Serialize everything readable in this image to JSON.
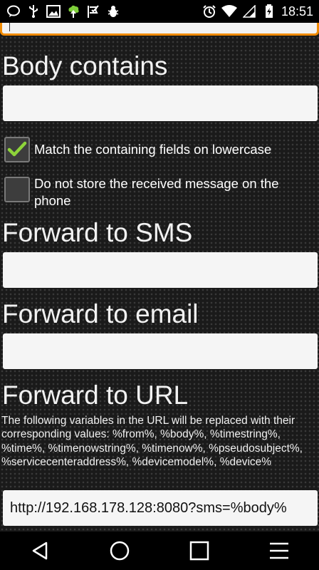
{
  "status_bar": {
    "time": "18:51",
    "left_icons": [
      "chat-bubble-icon",
      "usb-icon",
      "image-icon",
      "upload-icon",
      "check-flag-icon",
      "bug-icon"
    ],
    "right_icons": [
      "alarm-icon",
      "wifi-icon",
      "signal-icon",
      "battery-icon"
    ]
  },
  "form": {
    "body_contains": {
      "title": "Body contains",
      "value": ""
    },
    "match_lowercase": {
      "label": "Match the containing fields on lowercase",
      "checked": true
    },
    "do_not_store": {
      "label": "Do not store the received message on the phone",
      "checked": false
    },
    "forward_sms": {
      "title": "Forward to SMS",
      "value": ""
    },
    "forward_email": {
      "title": "Forward to email",
      "value": ""
    },
    "forward_url": {
      "title": "Forward to URL",
      "help": "The following variables in the URL will be replaced with their corresponding values: %from%, %body%, %timestring%, %time%, %timenowstring%, %timenow%, %pseudosubject%, %servicecenteraddress%, %devicemodel%, %device%",
      "value": "http://192.168.178.128:8080?sms=%body%"
    }
  },
  "colors": {
    "accent": "#f08a00",
    "check": "#8ed43a",
    "background": "#1a1a1a"
  },
  "nav": [
    "back-icon",
    "home-icon",
    "recents-icon",
    "menu-icon"
  ]
}
